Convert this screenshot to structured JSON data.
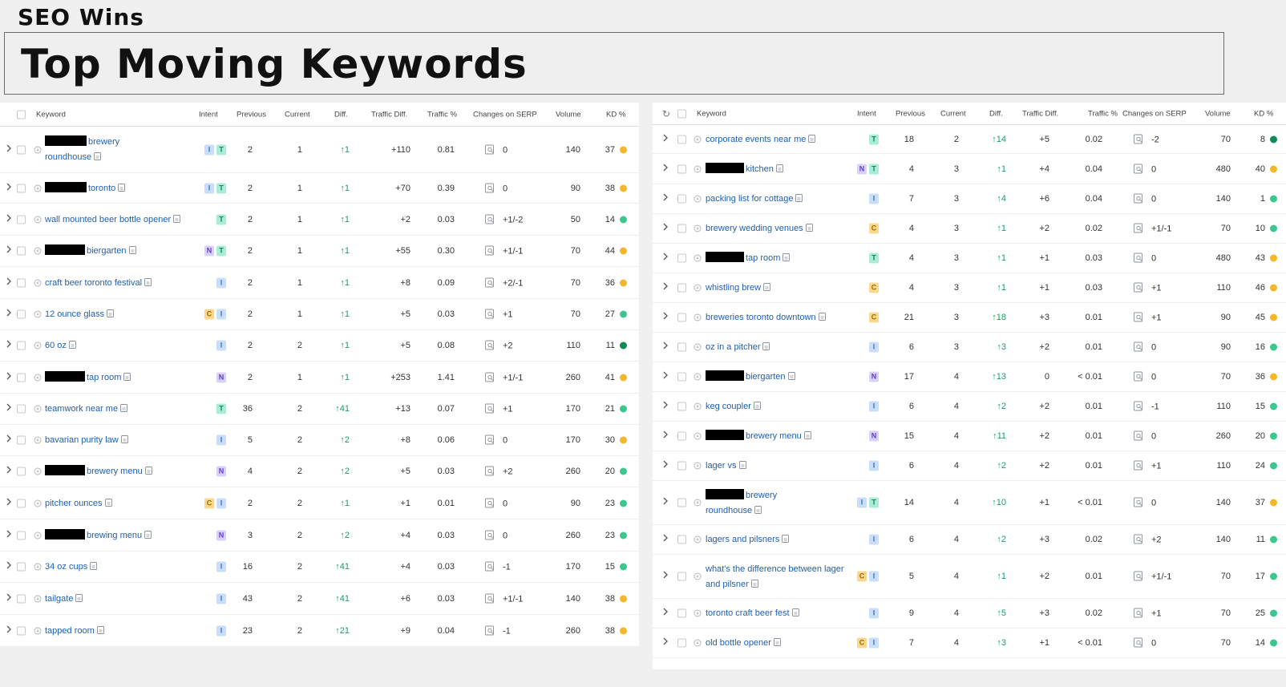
{
  "page": {
    "label": "SEO Wins",
    "title": "Top Moving Keywords"
  },
  "colors": {
    "kd_yellow": "#f4b728",
    "kd_green": "#3cc78f",
    "kd_dark_green": "#0f8a55",
    "link": "#1f5fb4",
    "diff_up": "#15a064"
  },
  "columns": {
    "keyword": "Keyword",
    "intent": "Intent",
    "previous": "Previous",
    "current": "Current",
    "diff": "Diff.",
    "traffic_diff": "Traffic Diff.",
    "traffic_pct": "Traffic %",
    "changes_serp": "Changes on SERP",
    "volume": "Volume",
    "kd": "KD %"
  },
  "left_table": [
    {
      "redact": 52,
      "kw": [
        "brewery",
        "roundhouse"
      ],
      "intent": [
        "I",
        "T"
      ],
      "previous": "2",
      "current": "1",
      "diff": "↑1",
      "traffic_diff": "+110",
      "traffic_pct": "0.81",
      "serp": "0",
      "volume": "140",
      "kd": "37",
      "kd_color": "yellow"
    },
    {
      "redact": 52,
      "kw": [
        "toronto"
      ],
      "intent": [
        "I",
        "T"
      ],
      "previous": "2",
      "current": "1",
      "diff": "↑1",
      "traffic_diff": "+70",
      "traffic_pct": "0.39",
      "serp": "0",
      "volume": "90",
      "kd": "38",
      "kd_color": "yellow"
    },
    {
      "redact": 0,
      "kw": [
        "wall mounted beer bottle opener"
      ],
      "intent": [
        "T"
      ],
      "previous": "2",
      "current": "1",
      "diff": "↑1",
      "traffic_diff": "+2",
      "traffic_pct": "0.03",
      "serp": "+1/-2",
      "volume": "50",
      "kd": "14",
      "kd_color": "green"
    },
    {
      "redact": 50,
      "kw": [
        "biergarten"
      ],
      "intent": [
        "N",
        "T"
      ],
      "previous": "2",
      "current": "1",
      "diff": "↑1",
      "traffic_diff": "+55",
      "traffic_pct": "0.30",
      "serp": "+1/-1",
      "volume": "70",
      "kd": "44",
      "kd_color": "yellow"
    },
    {
      "redact": 0,
      "kw": [
        "craft beer toronto festival"
      ],
      "intent": [
        "I"
      ],
      "previous": "2",
      "current": "1",
      "diff": "↑1",
      "traffic_diff": "+8",
      "traffic_pct": "0.09",
      "serp": "+2/-1",
      "volume": "70",
      "kd": "36",
      "kd_color": "yellow"
    },
    {
      "redact": 0,
      "kw": [
        "12 ounce glass"
      ],
      "intent": [
        "C",
        "I"
      ],
      "previous": "2",
      "current": "1",
      "diff": "↑1",
      "traffic_diff": "+5",
      "traffic_pct": "0.03",
      "serp": "+1",
      "volume": "70",
      "kd": "27",
      "kd_color": "green"
    },
    {
      "redact": 0,
      "kw": [
        "60 oz"
      ],
      "intent": [
        "I"
      ],
      "previous": "2",
      "current": "2",
      "diff": "↑1",
      "traffic_diff": "+5",
      "traffic_pct": "0.08",
      "serp": "+2",
      "volume": "110",
      "kd": "11",
      "kd_color": "dark_green"
    },
    {
      "redact": 50,
      "kw": [
        "tap room"
      ],
      "intent": [
        "N"
      ],
      "previous": "2",
      "current": "1",
      "diff": "↑1",
      "traffic_diff": "+253",
      "traffic_pct": "1.41",
      "serp": "+1/-1",
      "volume": "260",
      "kd": "41",
      "kd_color": "yellow"
    },
    {
      "redact": 0,
      "kw": [
        "teamwork near me"
      ],
      "intent": [
        "T"
      ],
      "previous": "36",
      "current": "2",
      "diff": "↑41",
      "traffic_diff": "+13",
      "traffic_pct": "0.07",
      "serp": "+1",
      "volume": "170",
      "kd": "21",
      "kd_color": "green"
    },
    {
      "redact": 0,
      "kw": [
        "bavarian purity law"
      ],
      "intent": [
        "I"
      ],
      "previous": "5",
      "current": "2",
      "diff": "↑2",
      "traffic_diff": "+8",
      "traffic_pct": "0.06",
      "serp": "0",
      "volume": "170",
      "kd": "30",
      "kd_color": "yellow"
    },
    {
      "redact": 50,
      "kw": [
        "brewery menu"
      ],
      "intent": [
        "N"
      ],
      "previous": "4",
      "current": "2",
      "diff": "↑2",
      "traffic_diff": "+5",
      "traffic_pct": "0.03",
      "serp": "+2",
      "volume": "260",
      "kd": "20",
      "kd_color": "green"
    },
    {
      "redact": 0,
      "kw": [
        "pitcher ounces"
      ],
      "intent": [
        "C",
        "I"
      ],
      "previous": "2",
      "current": "2",
      "diff": "↑1",
      "traffic_diff": "+1",
      "traffic_pct": "0.01",
      "serp": "0",
      "volume": "90",
      "kd": "23",
      "kd_color": "green"
    },
    {
      "redact": 50,
      "kw": [
        "brewing menu"
      ],
      "intent": [
        "N"
      ],
      "previous": "3",
      "current": "2",
      "diff": "↑2",
      "traffic_diff": "+4",
      "traffic_pct": "0.03",
      "serp": "0",
      "volume": "260",
      "kd": "23",
      "kd_color": "green"
    },
    {
      "redact": 0,
      "kw": [
        "34 oz cups"
      ],
      "intent": [
        "I"
      ],
      "previous": "16",
      "current": "2",
      "diff": "↑41",
      "traffic_diff": "+4",
      "traffic_pct": "0.03",
      "serp": "-1",
      "volume": "170",
      "kd": "15",
      "kd_color": "green"
    },
    {
      "redact": 0,
      "kw": [
        "tailgate"
      ],
      "intent": [
        "I"
      ],
      "previous": "43",
      "current": "2",
      "diff": "↑41",
      "traffic_diff": "+6",
      "traffic_pct": "0.03",
      "serp": "+1/-1",
      "volume": "140",
      "kd": "38",
      "kd_color": "yellow"
    },
    {
      "redact": 0,
      "kw": [
        "tapped room"
      ],
      "intent": [
        "I"
      ],
      "previous": "23",
      "current": "2",
      "diff": "↑21",
      "traffic_diff": "+9",
      "traffic_pct": "0.04",
      "serp": "-1",
      "volume": "260",
      "kd": "38",
      "kd_color": "yellow"
    }
  ],
  "right_table": [
    {
      "redact": 0,
      "kw": [
        "corporate events near me"
      ],
      "intent": [
        "T"
      ],
      "previous": "18",
      "current": "2",
      "diff": "↑14",
      "traffic_diff": "+5",
      "traffic_pct": "0.02",
      "serp": "-2",
      "volume": "70",
      "kd": "8",
      "kd_color": "dark_green"
    },
    {
      "redact": 48,
      "kw": [
        "kitchen"
      ],
      "intent": [
        "N",
        "T"
      ],
      "previous": "4",
      "current": "3",
      "diff": "↑1",
      "traffic_diff": "+4",
      "traffic_pct": "0.04",
      "serp": "0",
      "volume": "480",
      "kd": "40",
      "kd_color": "yellow"
    },
    {
      "redact": 0,
      "kw": [
        "packing list for cottage"
      ],
      "intent": [
        "I"
      ],
      "previous": "7",
      "current": "3",
      "diff": "↑4",
      "traffic_diff": "+6",
      "traffic_pct": "0.04",
      "serp": "0",
      "volume": "140",
      "kd": "1",
      "kd_color": "green"
    },
    {
      "redact": 0,
      "kw": [
        "brewery wedding venues"
      ],
      "intent": [
        "C"
      ],
      "previous": "4",
      "current": "3",
      "diff": "↑1",
      "traffic_diff": "+2",
      "traffic_pct": "0.02",
      "serp": "+1/-1",
      "volume": "70",
      "kd": "10",
      "kd_color": "green"
    },
    {
      "redact": 48,
      "kw": [
        "tap room"
      ],
      "intent": [
        "T"
      ],
      "previous": "4",
      "current": "3",
      "diff": "↑1",
      "traffic_diff": "+1",
      "traffic_pct": "0.03",
      "serp": "0",
      "volume": "480",
      "kd": "43",
      "kd_color": "yellow"
    },
    {
      "redact": 0,
      "kw": [
        "whistling brew"
      ],
      "intent": [
        "C"
      ],
      "previous": "4",
      "current": "3",
      "diff": "↑1",
      "traffic_diff": "+1",
      "traffic_pct": "0.03",
      "serp": "+1",
      "volume": "110",
      "kd": "46",
      "kd_color": "yellow"
    },
    {
      "redact": 0,
      "kw": [
        "breweries toronto downtown"
      ],
      "intent": [
        "C"
      ],
      "previous": "21",
      "current": "3",
      "diff": "↑18",
      "traffic_diff": "+3",
      "traffic_pct": "0.01",
      "serp": "+1",
      "volume": "90",
      "kd": "45",
      "kd_color": "yellow"
    },
    {
      "redact": 0,
      "kw": [
        "oz in a pitcher"
      ],
      "intent": [
        "I"
      ],
      "previous": "6",
      "current": "3",
      "diff": "↑3",
      "traffic_diff": "+2",
      "traffic_pct": "0.01",
      "serp": "0",
      "volume": "90",
      "kd": "16",
      "kd_color": "green"
    },
    {
      "redact": 48,
      "kw": [
        "biergarten"
      ],
      "intent": [
        "N"
      ],
      "previous": "17",
      "current": "4",
      "diff": "↑13",
      "traffic_diff": "0",
      "traffic_pct": "< 0.01",
      "serp": "0",
      "volume": "70",
      "kd": "36",
      "kd_color": "yellow"
    },
    {
      "redact": 0,
      "kw": [
        "keg coupler"
      ],
      "intent": [
        "I"
      ],
      "previous": "6",
      "current": "4",
      "diff": "↑2",
      "traffic_diff": "+2",
      "traffic_pct": "0.01",
      "serp": "-1",
      "volume": "110",
      "kd": "15",
      "kd_color": "green"
    },
    {
      "redact": 48,
      "kw": [
        "brewery menu"
      ],
      "intent": [
        "N"
      ],
      "previous": "15",
      "current": "4",
      "diff": "↑11",
      "traffic_diff": "+2",
      "traffic_pct": "0.01",
      "serp": "0",
      "volume": "260",
      "kd": "20",
      "kd_color": "green"
    },
    {
      "redact": 0,
      "kw": [
        "lager vs"
      ],
      "intent": [
        "I"
      ],
      "previous": "6",
      "current": "4",
      "diff": "↑2",
      "traffic_diff": "+2",
      "traffic_pct": "0.01",
      "serp": "+1",
      "volume": "110",
      "kd": "24",
      "kd_color": "green"
    },
    {
      "redact": 48,
      "kw": [
        "brewery",
        "roundhouse"
      ],
      "intent": [
        "I",
        "T"
      ],
      "previous": "14",
      "current": "4",
      "diff": "↑10",
      "traffic_diff": "+1",
      "traffic_pct": "< 0.01",
      "serp": "0",
      "volume": "140",
      "kd": "37",
      "kd_color": "yellow"
    },
    {
      "redact": 0,
      "kw": [
        "lagers and pilsners"
      ],
      "intent": [
        "I"
      ],
      "previous": "6",
      "current": "4",
      "diff": "↑2",
      "traffic_diff": "+3",
      "traffic_pct": "0.02",
      "serp": "+2",
      "volume": "140",
      "kd": "11",
      "kd_color": "green"
    },
    {
      "redact": 0,
      "kw": [
        "what's the difference between lager",
        "and pilsner"
      ],
      "intent": [
        "C",
        "I"
      ],
      "previous": "5",
      "current": "4",
      "diff": "↑1",
      "traffic_diff": "+2",
      "traffic_pct": "0.01",
      "serp": "+1/-1",
      "volume": "70",
      "kd": "17",
      "kd_color": "green"
    },
    {
      "redact": 0,
      "kw": [
        "toronto craft beer fest"
      ],
      "intent": [
        "I"
      ],
      "previous": "9",
      "current": "4",
      "diff": "↑5",
      "traffic_diff": "+3",
      "traffic_pct": "0.02",
      "serp": "+1",
      "volume": "70",
      "kd": "25",
      "kd_color": "green"
    },
    {
      "redact": 0,
      "kw": [
        "old bottle opener"
      ],
      "intent": [
        "C",
        "I"
      ],
      "previous": "7",
      "current": "4",
      "diff": "↑3",
      "traffic_diff": "+1",
      "traffic_pct": "< 0.01",
      "serp": "0",
      "volume": "70",
      "kd": "14",
      "kd_color": "green"
    }
  ]
}
